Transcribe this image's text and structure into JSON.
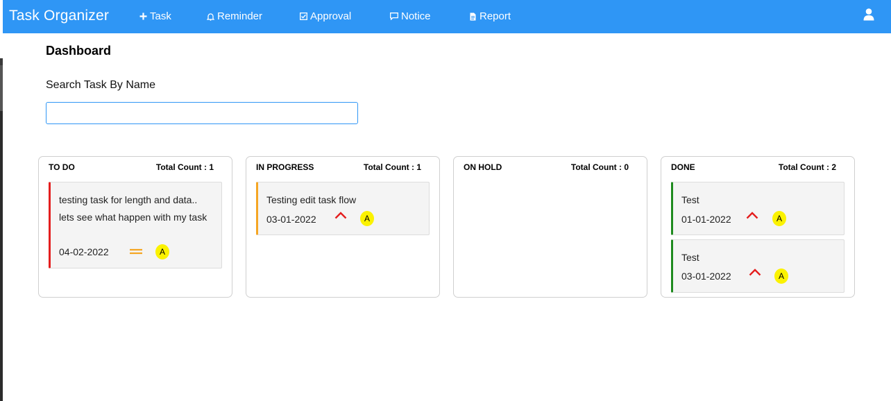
{
  "app": {
    "title": "Task Organizer"
  },
  "nav": {
    "items": [
      {
        "label": "Task",
        "icon": "plus-icon"
      },
      {
        "label": "Reminder",
        "icon": "bell-icon"
      },
      {
        "label": "Approval",
        "icon": "check-square-icon"
      },
      {
        "label": "Notice",
        "icon": "message-icon"
      },
      {
        "label": "Report",
        "icon": "document-icon"
      }
    ],
    "user_icon": "user-icon"
  },
  "dashboard": {
    "title": "Dashboard",
    "search": {
      "label": "Search Task By Name",
      "value": "",
      "placeholder": ""
    }
  },
  "columns": [
    {
      "title": "TO DO",
      "count_label": "Total Count : 1",
      "accent": "#e41e1e",
      "cards": [
        {
          "text": "testing task for length and data.. lets see what happen with my task",
          "date": "04-02-2022",
          "priority": "medium",
          "priority_color": "#f5a623",
          "assignee": "A"
        }
      ]
    },
    {
      "title": "IN PROGRESS",
      "count_label": "Total Count : 1",
      "accent": "#f5a623",
      "cards": [
        {
          "text": "Testing edit task flow",
          "date": "03-01-2022",
          "priority": "high",
          "priority_color": "#e41e1e",
          "assignee": "A"
        }
      ]
    },
    {
      "title": "ON HOLD",
      "count_label": "Total Count : 0",
      "accent": "#999999",
      "cards": []
    },
    {
      "title": "DONE",
      "count_label": "Total Count : 2",
      "accent": "#1e8a1e",
      "cards": [
        {
          "text": "Test",
          "date": "01-01-2022",
          "priority": "high",
          "priority_color": "#e41e1e",
          "assignee": "A"
        },
        {
          "text": "Test",
          "date": "03-01-2022",
          "priority": "high",
          "priority_color": "#e41e1e",
          "assignee": "A"
        }
      ]
    }
  ],
  "colors": {
    "navbar": "#2f96f5",
    "avatar": "#fbf200",
    "high_priority": "#e41e1e",
    "medium_priority": "#f5a623"
  }
}
